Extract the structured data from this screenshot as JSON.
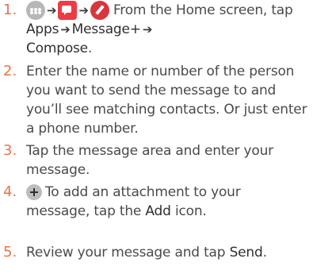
{
  "steps": [
    {
      "number": "1.",
      "text_a": "From the Home screen, tap",
      "apps": "Apps",
      "message_plus": "Message+",
      "compose": "Compose",
      "end": ".",
      "icons": [
        "apps-icon",
        "message-plus-icon",
        "compose-icon"
      ]
    },
    {
      "number": "2.",
      "text": "Enter the name or number of the person you want to send the message to and you’ll see matching contacts. Or just enter a phone number."
    },
    {
      "number": "3.",
      "text": "Tap the message area and enter your message."
    },
    {
      "number": "4.",
      "text_a": "To add an attachment to your message, tap the",
      "add": "Add",
      "text_b": "icon.",
      "icon": "add-icon"
    },
    {
      "number": "5.",
      "text_a": "Review your message and tap",
      "send": "Send",
      "end": "."
    }
  ],
  "colors": {
    "number": "#e8734a",
    "text": "#4a4a4a",
    "message_icon": "#ee3b43",
    "compose_icon": "#d8363d"
  }
}
